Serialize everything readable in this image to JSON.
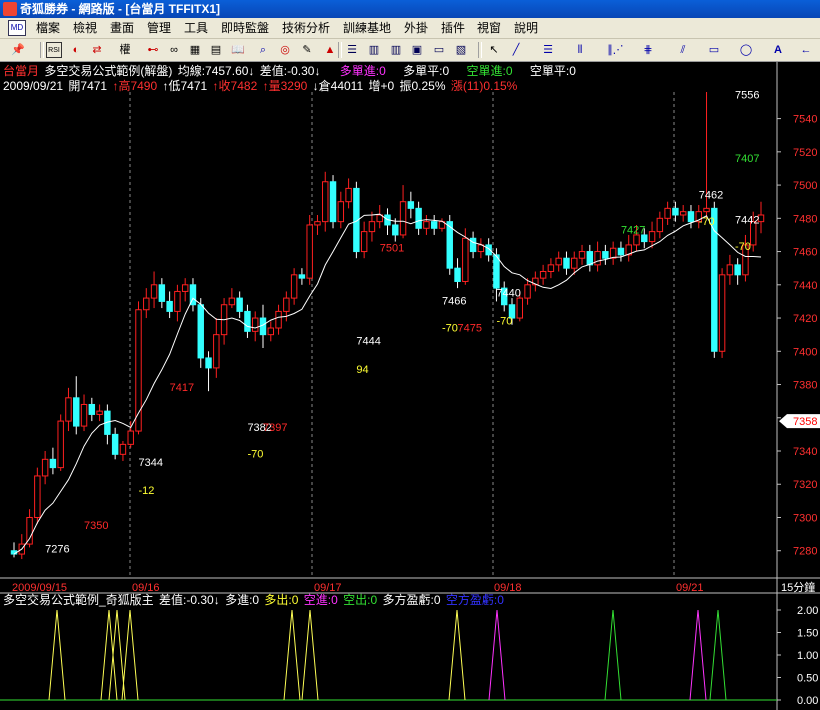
{
  "window": {
    "title": "奇狐勝券 - 網路版 - [台當月 TFFITX1]"
  },
  "menu": {
    "items": [
      "檔案",
      "檢視",
      "畫面",
      "管理",
      "工具",
      "即時監盤",
      "技術分析",
      "訓練基地",
      "外掛",
      "插件",
      "視窗",
      "說明"
    ]
  },
  "toolbar": {
    "buttons": [
      "pin-icon",
      "rsi-icon",
      "refresh-icon",
      "arrows-icon",
      "weight-icon",
      "link-icon",
      "glasses-icon",
      "grid-icon",
      "layout-icon",
      "book-icon",
      "search-icon",
      "target-icon",
      "ruler-icon",
      "alarm-icon",
      "list-icon",
      "window-icon",
      "tile-icon",
      "chart-icon",
      "cursor-icon",
      "line-icon",
      "fib-icon",
      "vbar-icon",
      "fan-icon",
      "channel-icon",
      "parallel-icon",
      "rect-icon",
      "ellipse-icon",
      "text-icon",
      "arrow-icon"
    ],
    "labels": {
      "weight": "權"
    }
  },
  "header": {
    "symbol": "台當月",
    "strategy": "多空交易公式範例(解盤)",
    "avg": "均線:7457.60↓",
    "diff": "差值:-0.30↓",
    "long_in": "多單進:0",
    "long_flat": "多單平:0",
    "short_in": "空單進:0",
    "short_flat": "空單平:0",
    "date": "2009/09/21",
    "open": "開7471",
    "high": "↑高7490",
    "low": "↑低7471",
    "close": "↑收7482",
    "vol": "↑量3290",
    "oi": "↓倉44011",
    "inc": "增+0",
    "amp": "振0.25%",
    "chg": "漲(11)0.15%"
  },
  "chart_data": {
    "type": "candlestick",
    "timeframe": "15分鐘",
    "ylim": [
      7266,
      7556
    ],
    "yticks": [
      7280,
      7300,
      7320,
      7340,
      7360,
      7380,
      7400,
      7420,
      7440,
      7460,
      7480,
      7500,
      7520,
      7540
    ],
    "price_tag": "7358",
    "x_labels": [
      "2009/09/15",
      "09/16",
      "09/17",
      "09/18",
      "09/21"
    ],
    "candles": [
      [
        7280,
        7278,
        7285,
        7276
      ],
      [
        7278,
        7284,
        7290,
        7275
      ],
      [
        7284,
        7300,
        7305,
        7282
      ],
      [
        7300,
        7325,
        7330,
        7296
      ],
      [
        7325,
        7335,
        7340,
        7320
      ],
      [
        7335,
        7330,
        7342,
        7326
      ],
      [
        7330,
        7358,
        7362,
        7328
      ],
      [
        7358,
        7372,
        7378,
        7352
      ],
      [
        7372,
        7355,
        7385,
        7350
      ],
      [
        7355,
        7368,
        7374,
        7352
      ],
      [
        7368,
        7362,
        7372,
        7358
      ],
      [
        7362,
        7364,
        7368,
        7358
      ],
      [
        7364,
        7350,
        7368,
        7344
      ],
      [
        7350,
        7338,
        7354,
        7335
      ],
      [
        7338,
        7344,
        7346,
        7334
      ],
      [
        7344,
        7352,
        7358,
        7342
      ],
      [
        7352,
        7425,
        7430,
        7350
      ],
      [
        7425,
        7432,
        7438,
        7420
      ],
      [
        7432,
        7440,
        7448,
        7426
      ],
      [
        7440,
        7430,
        7444,
        7426
      ],
      [
        7430,
        7424,
        7436,
        7420
      ],
      [
        7424,
        7436,
        7440,
        7418
      ],
      [
        7436,
        7440,
        7444,
        7430
      ],
      [
        7440,
        7428,
        7444,
        7424
      ],
      [
        7428,
        7396,
        7432,
        7390
      ],
      [
        7396,
        7390,
        7400,
        7376
      ],
      [
        7390,
        7410,
        7420,
        7384
      ],
      [
        7410,
        7428,
        7432,
        7404
      ],
      [
        7428,
        7432,
        7438,
        7426
      ],
      [
        7432,
        7424,
        7436,
        7420
      ],
      [
        7424,
        7412,
        7428,
        7408
      ],
      [
        7412,
        7420,
        7424,
        7406
      ],
      [
        7420,
        7410,
        7428,
        7402
      ],
      [
        7410,
        7414,
        7418,
        7406
      ],
      [
        7414,
        7424,
        7428,
        7410
      ],
      [
        7424,
        7432,
        7436,
        7418
      ],
      [
        7432,
        7446,
        7450,
        7428
      ],
      [
        7446,
        7444,
        7450,
        7440
      ],
      [
        7444,
        7476,
        7482,
        7440
      ],
      [
        7476,
        7478,
        7482,
        7470
      ],
      [
        7478,
        7502,
        7508,
        7472
      ],
      [
        7502,
        7478,
        7506,
        7474
      ],
      [
        7478,
        7490,
        7496,
        7474
      ],
      [
        7490,
        7498,
        7504,
        7486
      ],
      [
        7498,
        7460,
        7502,
        7456
      ],
      [
        7460,
        7472,
        7478,
        7456
      ],
      [
        7472,
        7478,
        7484,
        7466
      ],
      [
        7478,
        7482,
        7488,
        7474
      ],
      [
        7482,
        7476,
        7486,
        7470
      ],
      [
        7476,
        7470,
        7480,
        7466
      ],
      [
        7470,
        7490,
        7500,
        7468
      ],
      [
        7490,
        7486,
        7496,
        7480
      ],
      [
        7486,
        7474,
        7490,
        7470
      ],
      [
        7474,
        7478,
        7482,
        7470
      ],
      [
        7478,
        7474,
        7482,
        7470
      ],
      [
        7474,
        7478,
        7480,
        7472
      ],
      [
        7478,
        7450,
        7482,
        7446
      ],
      [
        7450,
        7442,
        7456,
        7438
      ],
      [
        7442,
        7468,
        7474,
        7440
      ],
      [
        7468,
        7460,
        7472,
        7456
      ],
      [
        7460,
        7464,
        7468,
        7456
      ],
      [
        7464,
        7458,
        7468,
        7454
      ],
      [
        7458,
        7438,
        7462,
        7430
      ],
      [
        7438,
        7428,
        7442,
        7424
      ],
      [
        7428,
        7420,
        7432,
        7416
      ],
      [
        7420,
        7432,
        7436,
        7418
      ],
      [
        7432,
        7440,
        7444,
        7428
      ],
      [
        7440,
        7444,
        7448,
        7436
      ],
      [
        7444,
        7448,
        7452,
        7440
      ],
      [
        7448,
        7452,
        7456,
        7444
      ],
      [
        7452,
        7456,
        7460,
        7448
      ],
      [
        7456,
        7450,
        7460,
        7446
      ],
      [
        7450,
        7456,
        7460,
        7446
      ],
      [
        7456,
        7460,
        7464,
        7452
      ],
      [
        7460,
        7452,
        7464,
        7448
      ],
      [
        7452,
        7460,
        7466,
        7448
      ],
      [
        7460,
        7456,
        7464,
        7452
      ],
      [
        7456,
        7462,
        7466,
        7452
      ],
      [
        7462,
        7458,
        7466,
        7454
      ],
      [
        7458,
        7464,
        7470,
        7454
      ],
      [
        7464,
        7470,
        7476,
        7460
      ],
      [
        7470,
        7466,
        7474,
        7462
      ],
      [
        7466,
        7472,
        7478,
        7462
      ],
      [
        7472,
        7480,
        7484,
        7468
      ],
      [
        7480,
        7486,
        7490,
        7476
      ],
      [
        7486,
        7482,
        7490,
        7478
      ],
      [
        7482,
        7484,
        7488,
        7478
      ],
      [
        7484,
        7478,
        7488,
        7474
      ],
      [
        7478,
        7484,
        7488,
        7474
      ],
      [
        7484,
        7486,
        7556,
        7480
      ],
      [
        7486,
        7400,
        7490,
        7396
      ],
      [
        7400,
        7446,
        7450,
        7396
      ],
      [
        7446,
        7452,
        7458,
        7440
      ],
      [
        7452,
        7446,
        7456,
        7440
      ],
      [
        7446,
        7464,
        7470,
        7442
      ],
      [
        7464,
        7478,
        7484,
        7460
      ],
      [
        7478,
        7482,
        7490,
        7471
      ]
    ],
    "ma_label": "均線",
    "annotations": [
      {
        "text": "7276",
        "color": "#ffffff",
        "i": 4,
        "p": 7279
      },
      {
        "text": "7350",
        "color": "#ff2a2a",
        "i": 9,
        "p": 7293
      },
      {
        "text": "7344",
        "color": "#ffffff",
        "i": 16,
        "p": 7331
      },
      {
        "text": "-12",
        "color": "#ffff33",
        "i": 16,
        "p": 7314
      },
      {
        "text": "7417",
        "color": "#ff2a2a",
        "i": 20,
        "p": 7376
      },
      {
        "text": "7382",
        "color": "#ffffff",
        "i": 30,
        "p": 7352
      },
      {
        "text": "7397",
        "color": "#ff2a2a",
        "i": 32,
        "p": 7352
      },
      {
        "text": "-70",
        "color": "#ffff33",
        "i": 30,
        "p": 7336
      },
      {
        "text": "7444",
        "color": "#ffffff",
        "i": 44,
        "p": 7404
      },
      {
        "text": "94",
        "color": "#ffff33",
        "i": 44,
        "p": 7387
      },
      {
        "text": "7501",
        "color": "#ff2a2a",
        "i": 47,
        "p": 7460
      },
      {
        "text": "7466",
        "color": "#ffffff",
        "i": 55,
        "p": 7428
      },
      {
        "text": "-70",
        "color": "#ffff33",
        "i": 55,
        "p": 7412
      },
      {
        "text": "7475",
        "color": "#ff2a2a",
        "i": 57,
        "p": 7412
      },
      {
        "text": "7440",
        "color": "#ffffff",
        "i": 62,
        "p": 7433
      },
      {
        "text": "-70",
        "color": "#ffff33",
        "i": 62,
        "p": 7416
      },
      {
        "text": "7427",
        "color": "#33e033",
        "i": 78,
        "p": 7471
      },
      {
        "text": "7462",
        "color": "#ffffff",
        "i": 88,
        "p": 7492
      },
      {
        "text": "-70",
        "color": "#ffff33",
        "i": 88,
        "p": 7476
      },
      {
        "text": "7407",
        "color": "#33e033",
        "i": 106,
        "p": 7514
      },
      {
        "text": "7442",
        "color": "#ffffff",
        "i": 107,
        "p": 7477
      },
      {
        "text": "-70",
        "color": "#ffff33",
        "i": 107,
        "p": 7461
      },
      {
        "text": "7556",
        "color": "#ffffff",
        "i": 103,
        "p": 7552
      }
    ]
  },
  "indicator": {
    "name": "多空交易公式範例_奇狐版主",
    "diff": "差值:-0.30↓",
    "long_in": "多進:0",
    "long_out": "多出:0",
    "short_in": "空進:0",
    "short_out": "空出:0",
    "long_pl": "多方盈虧:0",
    "short_pl": "空方盈虧:0",
    "yticks": [
      "2.00",
      "1.50",
      "1.00",
      "0.50",
      "0.00"
    ],
    "spikes": [
      {
        "x": 57,
        "color": "#ffff55"
      },
      {
        "x": 109,
        "color": "#ffff55"
      },
      {
        "x": 117,
        "color": "#ffff55"
      },
      {
        "x": 130,
        "color": "#ffff55"
      },
      {
        "x": 292,
        "color": "#ffff55"
      },
      {
        "x": 310,
        "color": "#ffff55"
      },
      {
        "x": 457,
        "color": "#ffff55"
      },
      {
        "x": 497,
        "color": "#ff33ff"
      },
      {
        "x": 613,
        "color": "#33e033"
      },
      {
        "x": 698,
        "color": "#ff33ff"
      },
      {
        "x": 718,
        "color": "#33e033"
      }
    ]
  }
}
